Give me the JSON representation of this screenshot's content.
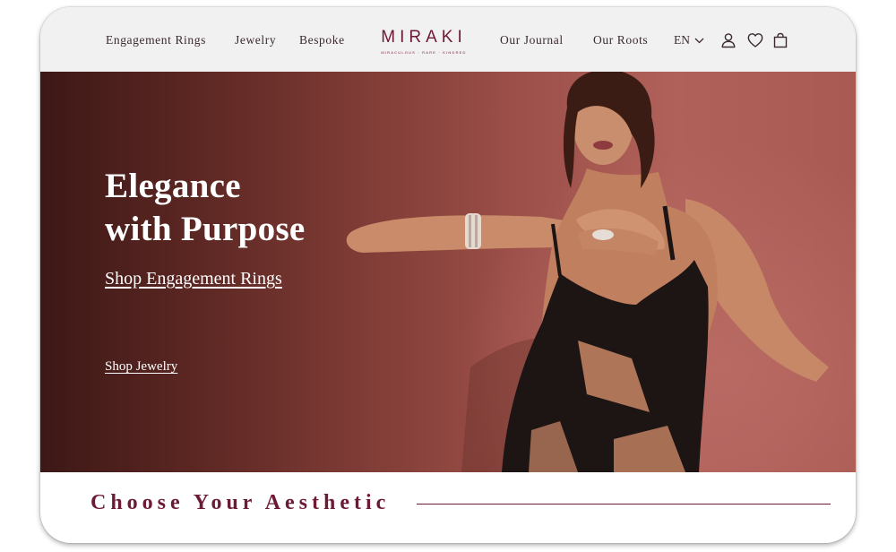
{
  "nav": {
    "left": [
      "Engagement Rings",
      "Jewelry",
      "Bespoke"
    ],
    "right": [
      "Our Journal",
      "Our Roots"
    ],
    "language": "EN"
  },
  "logo": {
    "word": "MIRAKI",
    "tagline": "MIRACULOUS · RARE · KINDRED"
  },
  "header_icons": [
    "user-icon",
    "heart-icon",
    "bag-icon"
  ],
  "hero": {
    "title_line1": "Elegance",
    "title_line2": "with Purpose",
    "cta_primary": "Shop Engagement Rings",
    "cta_secondary": "Shop Jewelry"
  },
  "section": {
    "title": "Choose Your Aesthetic"
  },
  "colors": {
    "brand": "#6d1b34",
    "header_bg": "#f2f1f1",
    "hero_bg": "#9b4f48"
  }
}
